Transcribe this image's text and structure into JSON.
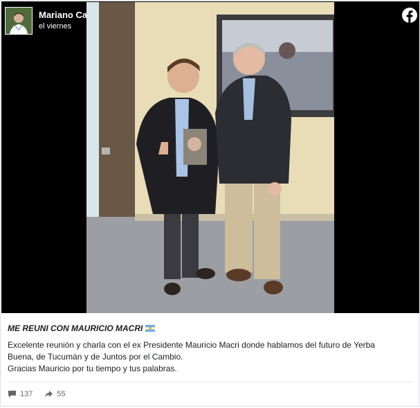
{
  "post": {
    "author": "Mariano Campero",
    "timestamp": "el viernes",
    "title": "ME REUNI CON MAURICIO MACRI",
    "body_lines": [
      "Excelente reunión y charla con el ex Presidente Mauricio Macri donde hablamos del futuro de Yerba",
      "Buena, de Tucumán y de Juntos por el Cambio.",
      "Gracias Mauricio por tu tiempo y tus palabras."
    ],
    "comments_count": "137",
    "shares_count": "55"
  },
  "colors": {
    "media_background": "#000000",
    "facebook_blue": "#1877f2",
    "text": "#1c1e21",
    "muted": "#65676b",
    "flag_blue": "#74acdf"
  },
  "icons": {
    "verified": "verified-badge-icon",
    "facebook": "facebook-logo-icon",
    "comments": "comment-icon",
    "shares": "share-icon",
    "flag": "argentina-flag-icon"
  }
}
